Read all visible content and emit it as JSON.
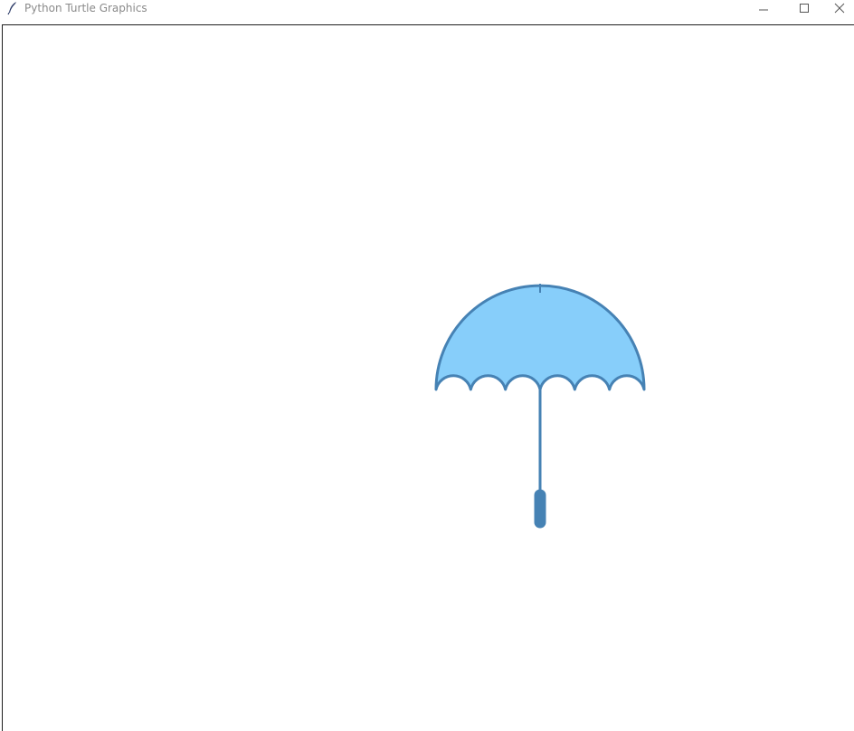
{
  "window": {
    "title": "Python Turtle Graphics",
    "icon": "feather-icon",
    "controls": {
      "minimize": "minimize-icon",
      "maximize": "maximize-icon",
      "close": "close-icon"
    }
  },
  "canvas": {
    "background": "#ffffff",
    "drawing": {
      "subject": "umbrella",
      "canopy_fill": "#87cefa",
      "outline_color": "#4682b4",
      "scallop_count": 6
    }
  }
}
